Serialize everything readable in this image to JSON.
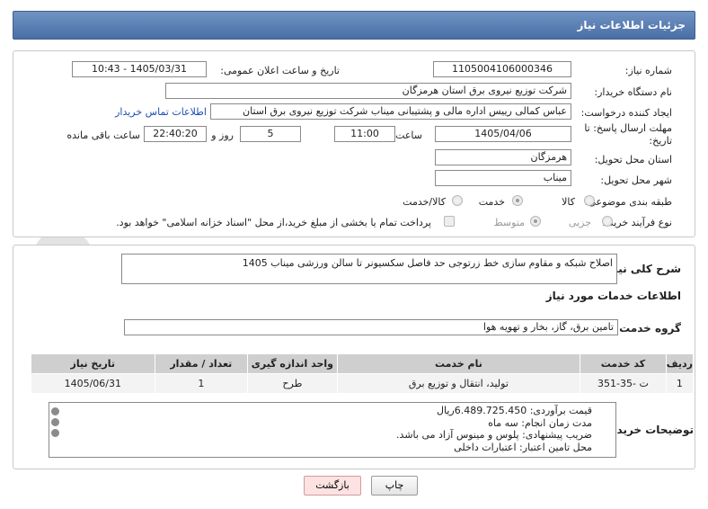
{
  "header": {
    "title": "جزئیات اطلاعات نیاز"
  },
  "form": {
    "need_number": {
      "label": "شماره نیاز:",
      "value": "1105004106000346"
    },
    "announce": {
      "label": "تاریخ و ساعت اعلان عمومی:",
      "value": "1405/03/31 - 10:43"
    },
    "buyer_org": {
      "label": "نام دستگاه خریدار:",
      "value": "شرکت توزیع نیروی برق استان هرمزگان"
    },
    "requester": {
      "label": "ایجاد کننده درخواست:",
      "value": "عباس کمالی رییس اداره مالی و پشتیبانی میناب شرکت توزیع نیروی برق استان",
      "contact_link": "اطلاعات تماس خریدار"
    },
    "deadline": {
      "label": "مهلت ارسال پاسخ: تا تاریخ:",
      "date": "1405/04/06",
      "time_label": "ساعت",
      "time": "11:00",
      "days": "5",
      "days_label": "روز و",
      "remaining": "22:40:20",
      "remaining_label": "ساعت باقی مانده"
    },
    "province": {
      "label": "استان محل تحویل:",
      "value": "هرمزگان"
    },
    "city": {
      "label": "شهر محل تحویل:",
      "value": "میناب"
    },
    "category": {
      "label": "طبقه بندی موضوعی:",
      "options": [
        "کالا",
        "خدمت",
        "کالا/خدمت"
      ],
      "selected": "خدمت"
    },
    "purchase_type": {
      "label": "نوع فرآیند خرید :",
      "options": [
        "جزیی",
        "متوسط"
      ],
      "selected": "متوسط",
      "payment_note": "پرداخت تمام یا بخشی از مبلغ خرید،از محل \"اسناد خزانه اسلامی\" خواهد بود."
    }
  },
  "description": {
    "label": "شرح کلی نیاز:",
    "value": "اصلاح شبکه و مقاوم سازی خط زرتوجی حد فاصل سکسیونر تا سالن ورزشی میناب  1405"
  },
  "services": {
    "section_title": "اطلاعات خدمات مورد نیاز",
    "group_label": "گروه خدمت:",
    "group_value": "تامین برق، گاز، بخار و تهویه هوا",
    "columns": [
      "ردیف",
      "کد خدمت",
      "نام خدمت",
      "واحد اندازه گیری",
      "تعداد / مقدار",
      "تاریخ نیاز"
    ],
    "rows": [
      [
        "1",
        "ت -35-351",
        "تولید، انتقال و توزیع برق",
        "طرح",
        "1",
        "1405/06/31"
      ]
    ]
  },
  "notes": {
    "label": "توضیحات خریدار:",
    "lines": [
      "قیمت برآوردی: 6.489.725.450ریال",
      "مدت زمان انجام: سه ماه",
      "ضریب پیشنهادی: پلوس  و مینوس آزاد می باشد.",
      "محل تامین اعتبار:  اعتبارات  داخلی"
    ]
  },
  "buttons": {
    "print": "چاپ",
    "back": "بازگشت"
  },
  "watermark": {
    "text": "AriaTender.neT"
  },
  "colors": {
    "header": "#4a6fa5",
    "link": "#1a4fb0",
    "back_button": "#fde2e2"
  }
}
